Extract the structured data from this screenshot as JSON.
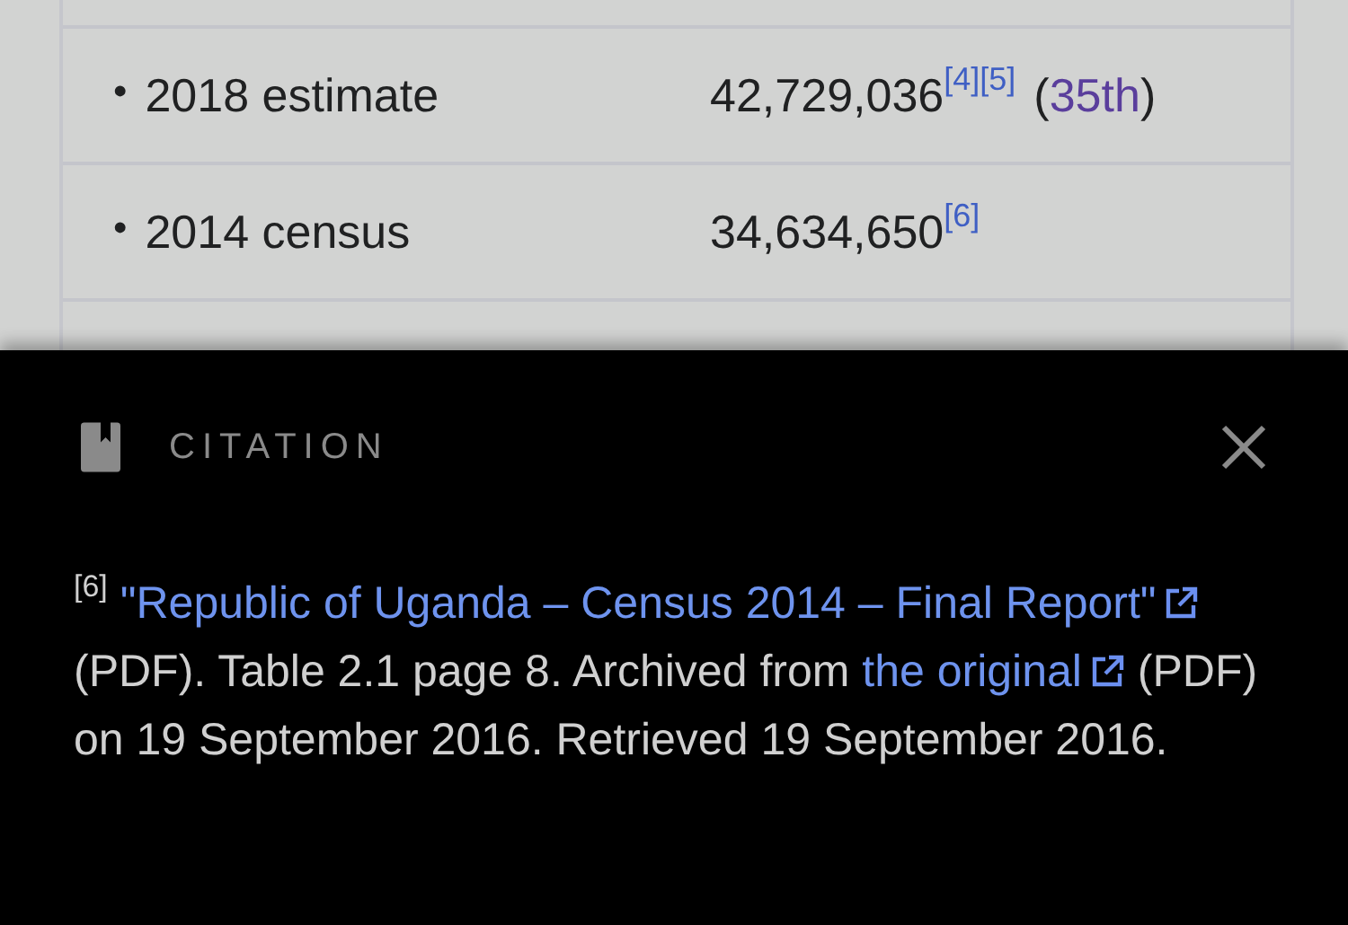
{
  "infobox": {
    "rows": [
      {
        "bullet": "•",
        "label": "2018 estimate",
        "value": "42,729,036",
        "refs": [
          "[4]",
          "[5]"
        ],
        "rank_open": "(",
        "rank": "35th",
        "rank_close": ")"
      },
      {
        "bullet": "•",
        "label": "2014 census",
        "value": "34,634,650",
        "refs": [
          "[6]"
        ]
      }
    ]
  },
  "citation_sheet": {
    "title": "CITATION",
    "ref": "[6]",
    "title_link": "\"Republic of Uganda – Census 2014 – Final Report\"",
    "text_1": "(PDF). Table 2.1 page 8. Archived from",
    "original_link": "the original",
    "text_2": "(PDF) on 19 September 2016. Retrieved 19 September 2016."
  }
}
